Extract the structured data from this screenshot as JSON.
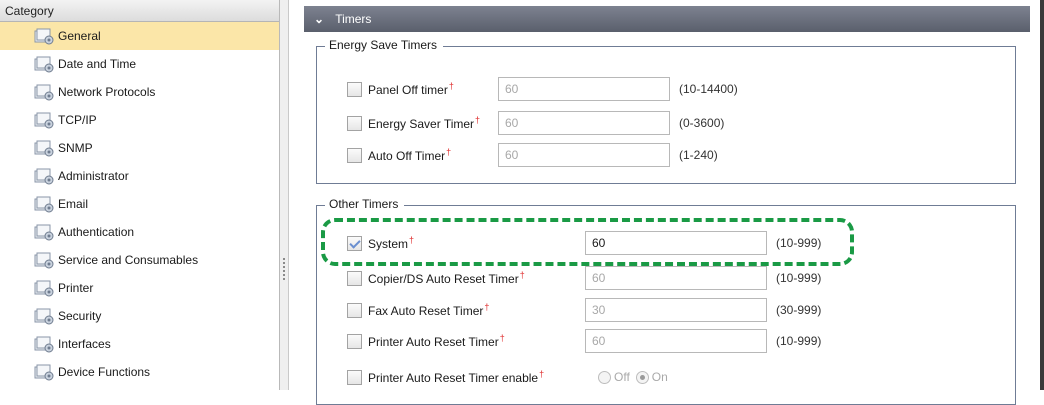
{
  "category": {
    "header": "Category",
    "items": [
      {
        "label": "General",
        "selected": true
      },
      {
        "label": "Date and Time"
      },
      {
        "label": "Network Protocols"
      },
      {
        "label": "TCP/IP"
      },
      {
        "label": "SNMP"
      },
      {
        "label": "Administrator"
      },
      {
        "label": "Email"
      },
      {
        "label": "Authentication"
      },
      {
        "label": "Service and Consumables"
      },
      {
        "label": "Printer"
      },
      {
        "label": "Security"
      },
      {
        "label": "Interfaces"
      },
      {
        "label": "Device Functions"
      }
    ]
  },
  "section": {
    "title": "Timers",
    "energy": {
      "legend": "Energy Save Timers",
      "rows": [
        {
          "label": "Panel Off timer",
          "value": "60",
          "range": "(10-14400)",
          "checked": false
        },
        {
          "label": "Energy Saver Timer",
          "value": "60",
          "range": "(0-3600)",
          "checked": false
        },
        {
          "label": "Auto Off Timer",
          "value": "60",
          "range": "(1-240)",
          "checked": false
        }
      ]
    },
    "other": {
      "legend": "Other Timers",
      "rows": [
        {
          "label": "System",
          "value": "60",
          "range": "(10-999)",
          "checked": true
        },
        {
          "label": "Copier/DS Auto Reset Timer",
          "value": "60",
          "range": "(10-999)",
          "checked": false
        },
        {
          "label": "Fax Auto Reset Timer",
          "value": "30",
          "range": "(30-999)",
          "checked": false
        },
        {
          "label": "Printer Auto Reset Timer",
          "value": "60",
          "range": "(10-999)",
          "checked": false
        }
      ],
      "enable_row": {
        "label": "Printer Auto Reset Timer enable",
        "off_label": "Off",
        "on_label": "On",
        "selected": "On"
      }
    }
  },
  "required_marker": "†",
  "colors": {
    "selected_bg": "#fbe6a8",
    "section_bar": "#5a5f6c",
    "highlight": "#1a9a45",
    "required": "#e03030"
  }
}
